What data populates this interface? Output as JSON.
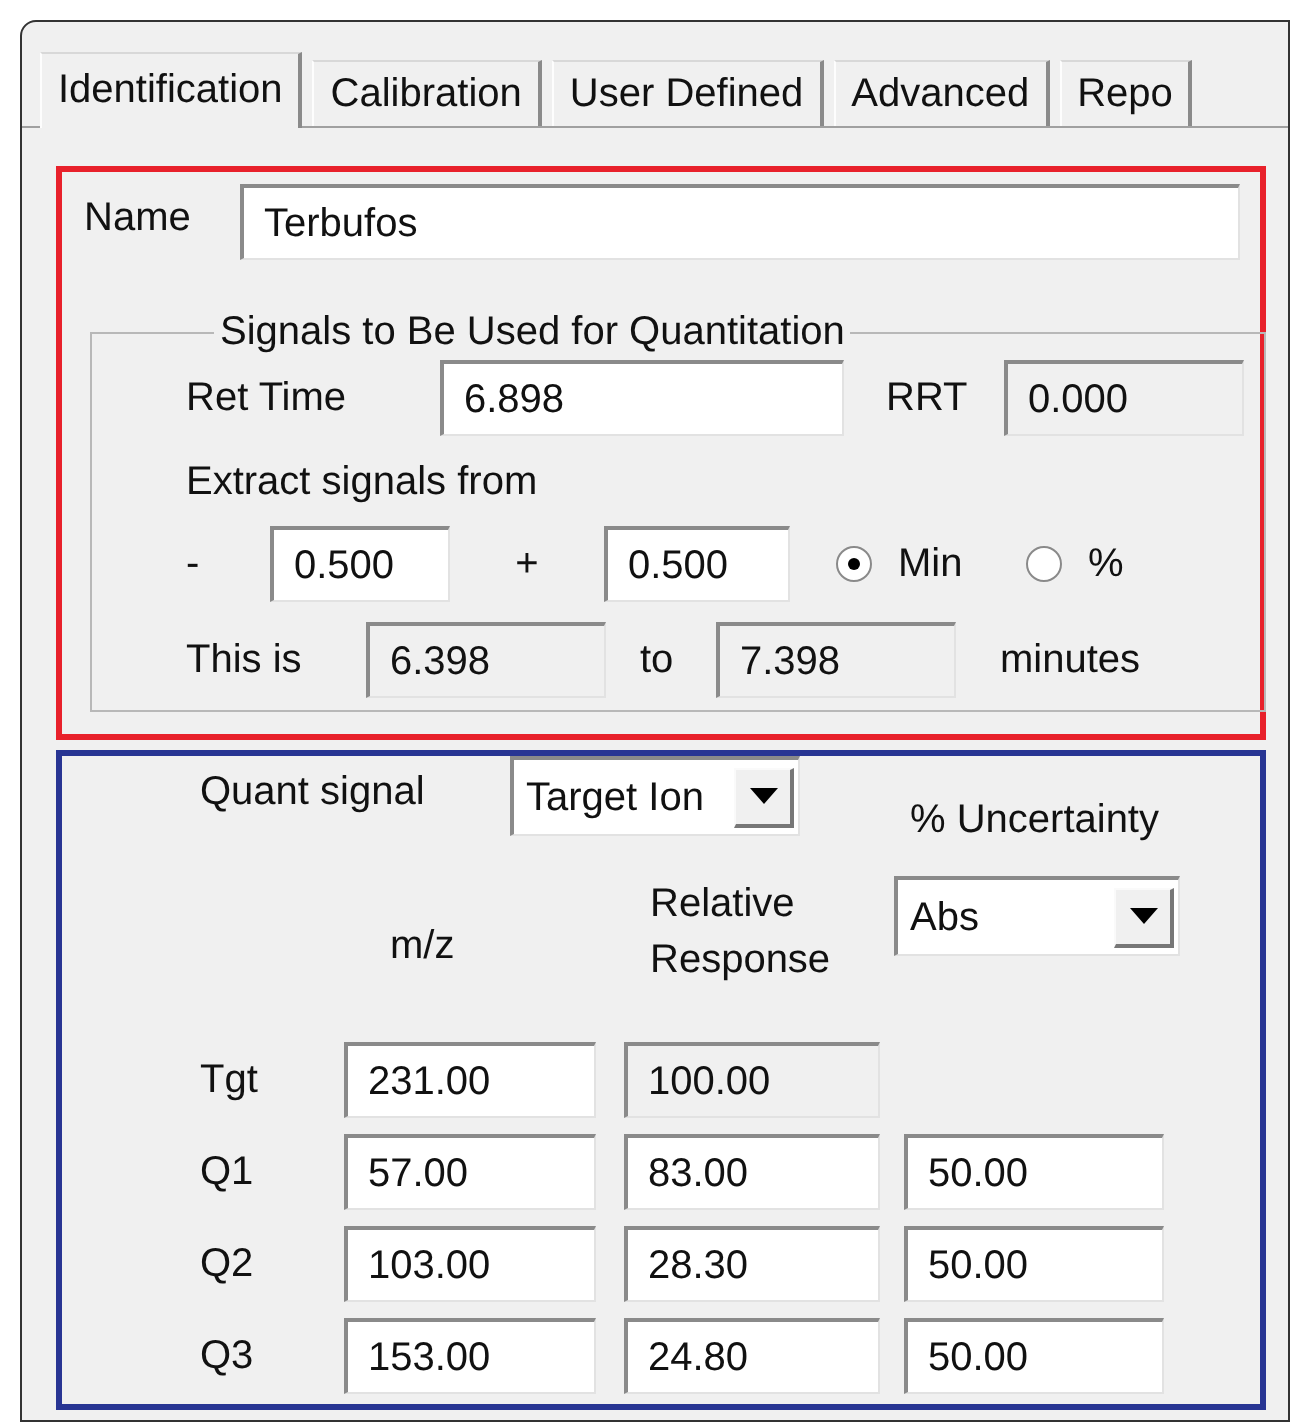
{
  "tabs": [
    {
      "label": "Identification",
      "selected": true
    },
    {
      "label": "Calibration",
      "selected": false
    },
    {
      "label": "User Defined",
      "selected": false
    },
    {
      "label": "Advanced",
      "selected": false
    },
    {
      "label": "Repo",
      "selected": false
    }
  ],
  "name": {
    "label": "Name",
    "value": "Terbufos"
  },
  "signals_group": {
    "title": "Signals to Be Used for Quantitation",
    "ret_time": {
      "label": "Ret Time",
      "value": "6.898"
    },
    "rrt": {
      "label": "RRT",
      "value": "0.000",
      "disabled": true
    },
    "extract_label": "Extract signals from",
    "minus_sign": "-",
    "minus_value": "0.500",
    "plus_sign": "+",
    "plus_value": "0.500",
    "units": [
      {
        "label": "Min",
        "selected": true
      },
      {
        "label": "%",
        "selected": false
      }
    ],
    "range_label": "This is",
    "from_value": "6.398",
    "from_disabled": true,
    "to_label": "to",
    "to_value": "7.398",
    "to_disabled": true,
    "unit_label": "minutes"
  },
  "quant_signal": {
    "label": "Quant signal",
    "value": "Target Ion"
  },
  "uncertainty": {
    "label": "% Uncertainty",
    "value": "Abs"
  },
  "columns": [
    "m/z",
    "Relative Response"
  ],
  "ions": [
    {
      "label": "Tgt",
      "mz": "231.00",
      "response": "100.00",
      "response_disabled": true
    },
    {
      "label": "Q1",
      "mz": "57.00",
      "response": "83.00",
      "response_disabled": false,
      "uncertainty": "50.00"
    },
    {
      "label": "Q2",
      "mz": "103.00",
      "response": "28.30",
      "response_disabled": false,
      "uncertainty": "50.00"
    },
    {
      "label": "Q3",
      "mz": "153.00",
      "response": "24.80",
      "response_disabled": false,
      "uncertainty": "50.00"
    }
  ]
}
